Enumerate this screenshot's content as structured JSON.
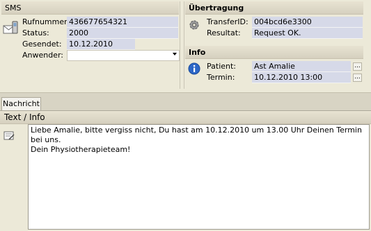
{
  "sms": {
    "title": "SMS",
    "fields": [
      {
        "label": "Rufnummer:",
        "value": "436677654321"
      },
      {
        "label": "Status:",
        "value": "2000"
      },
      {
        "label": "Gesendet:",
        "value": "10.12.2010"
      },
      {
        "label": "Anwender:",
        "value": ""
      }
    ]
  },
  "transfer": {
    "title": "Übertragung",
    "fields": [
      {
        "label": "TransferID:",
        "value": "004bcd6e3300"
      },
      {
        "label": "Resultat:",
        "value": "Request OK."
      }
    ]
  },
  "info": {
    "title": "Info",
    "fields": [
      {
        "label": "Patient:",
        "value": "Ast Amalie"
      },
      {
        "label": "Termin:",
        "value": "10.12.2010  13:00"
      }
    ],
    "ellipsis": "..."
  },
  "message": {
    "tab_label": "Nachricht",
    "header": "Text / Info",
    "text": "Liebe Amalie, bitte vergiss nicht, Du hast am 10.12.2010 um 13.00 Uhr Deinen Termin bei uns.\nDein Physiotherapieteam!"
  },
  "icons": {
    "sms": "phone-envelope-icon",
    "transfer": "gear-icon",
    "info": "info-icon",
    "message": "note-icon"
  }
}
